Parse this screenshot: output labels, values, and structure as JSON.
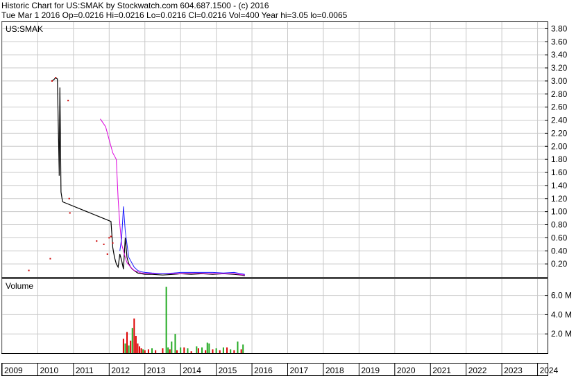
{
  "header": {
    "line1": "Historic Chart for US:SMAK by Stockwatch.com 604.687.1500 - (c) 2016",
    "line2": "Tue Mar  1 2016  Op=0.0216  Hi=0.0216  Lo=0.0216  Cl=0.0216  Vol=400  Year hi=3.05  lo=0.0065"
  },
  "colors": {
    "grid": "#c8c8c8",
    "price": "#000000",
    "price_dots": "#cc0000",
    "ma_short": "#1a1aff",
    "ma_long": "#dd00dd",
    "volume_up": "#22aa22",
    "volume_down": "#dd0000"
  },
  "chart_data": [
    {
      "type": "line",
      "title": "US:SMAK",
      "ylim": [
        0,
        3.9
      ],
      "xlim": [
        2009,
        2024.3
      ],
      "y_ticks": [
        "0.20",
        "0.40",
        "0.60",
        "0.80",
        "1.00",
        "1.20",
        "1.40",
        "1.60",
        "1.80",
        "2.00",
        "2.20",
        "2.40",
        "2.60",
        "2.80",
        "3.00",
        "3.20",
        "3.40",
        "3.60",
        "3.80"
      ],
      "x_ticks": [
        "2009",
        "2010",
        "2011",
        "2012",
        "2013",
        "2014",
        "2015",
        "2016",
        "2017",
        "2018",
        "2019",
        "2020",
        "2021",
        "2022",
        "2023",
        "2024"
      ],
      "series": [
        {
          "key": "price",
          "x": [
            2010.4,
            2010.45,
            2010.5,
            2010.55,
            2010.6,
            2010.6,
            2010.62,
            2010.65,
            2010.68,
            2010.7,
            2012.05,
            2012.1,
            2012.15,
            2012.2,
            2012.25,
            2012.3,
            2012.35,
            2012.4,
            2012.45,
            2012.5,
            2012.55,
            2012.6,
            2012.65,
            2012.7,
            2012.75,
            2012.8,
            2012.9,
            2013.0,
            2013.2,
            2013.5,
            2013.8,
            2014.0,
            2014.3,
            2014.6,
            2014.9,
            2015.2,
            2015.5,
            2015.7,
            2015.8
          ],
          "y": [
            3.0,
            3.02,
            3.05,
            3.03,
            1.6,
            1.55,
            2.9,
            1.3,
            1.2,
            1.15,
            0.85,
            0.45,
            0.3,
            0.2,
            0.15,
            0.35,
            0.25,
            0.12,
            0.6,
            0.3,
            0.2,
            0.15,
            0.12,
            0.1,
            0.08,
            0.06,
            0.05,
            0.04,
            0.04,
            0.03,
            0.04,
            0.05,
            0.04,
            0.05,
            0.04,
            0.05,
            0.04,
            0.03,
            0.02
          ]
        },
        {
          "key": "price_dots",
          "x": [
            2009.75,
            2010.35,
            2010.4,
            2010.5,
            2010.85,
            2010.88,
            2010.9,
            2011.65,
            2011.85,
            2011.95,
            2012.0,
            2012.05,
            2012.1
          ],
          "y": [
            0.1,
            0.28,
            3.0,
            3.05,
            2.7,
            1.2,
            0.98,
            0.55,
            0.5,
            0.35,
            0.6,
            0.62,
            0.52
          ]
        },
        {
          "key": "ma_long",
          "x": [
            2011.75,
            2011.9,
            2012.0,
            2012.1,
            2012.2,
            2012.25,
            2012.3,
            2012.35,
            2012.4,
            2012.45,
            2012.5,
            2012.6,
            2012.7,
            2012.9,
            2013.2,
            2013.6,
            2014.0,
            2014.4,
            2014.8,
            2015.2,
            2015.5,
            2015.8
          ],
          "y": [
            2.42,
            2.3,
            2.1,
            1.9,
            1.8,
            1.2,
            0.8,
            0.5,
            0.4,
            0.3,
            0.22,
            0.15,
            0.1,
            0.06,
            0.05,
            0.05,
            0.05,
            0.06,
            0.05,
            0.05,
            0.05,
            0.03
          ]
        },
        {
          "key": "ma_short",
          "x": [
            2012.3,
            2012.35,
            2012.4,
            2012.45,
            2012.5,
            2012.55,
            2012.6,
            2012.65,
            2012.7,
            2012.8,
            2012.9,
            2013.0,
            2013.2,
            2013.5,
            2013.8,
            2014.0,
            2014.3,
            2014.6,
            2014.9,
            2015.2,
            2015.5,
            2015.8
          ],
          "y": [
            0.4,
            0.6,
            1.08,
            0.7,
            0.5,
            0.3,
            0.25,
            0.2,
            0.15,
            0.1,
            0.08,
            0.07,
            0.06,
            0.05,
            0.06,
            0.07,
            0.07,
            0.07,
            0.07,
            0.06,
            0.07,
            0.04
          ]
        }
      ]
    },
    {
      "type": "bar",
      "title": "Volume",
      "ylim": [
        0,
        7.7
      ],
      "y_ticks": [
        "2.0 M",
        "4.0 M",
        "6.0 M"
      ],
      "series": [
        {
          "key": "volume_down",
          "x": [
            2012.4,
            2012.5,
            2012.6,
            2012.7,
            2012.75,
            2012.8,
            2012.85,
            2012.9,
            2013.0,
            2013.1,
            2013.3,
            2013.5,
            2013.7,
            2013.9,
            2014.1,
            2014.3,
            2014.5,
            2014.7,
            2014.9,
            2015.1,
            2015.3,
            2015.5,
            2015.7
          ],
          "y": [
            1.5,
            2.2,
            1.3,
            3.6,
            1.8,
            1.0,
            0.7,
            0.5,
            0.3,
            0.4,
            0.3,
            0.5,
            0.4,
            0.3,
            0.6,
            0.2,
            0.5,
            0.3,
            0.4,
            0.3,
            0.6,
            0.3,
            0.4
          ]
        },
        {
          "key": "volume_up",
          "x": [
            2012.45,
            2012.55,
            2012.65,
            2012.95,
            2013.2,
            2013.6,
            2013.65,
            2013.75,
            2013.85,
            2014.0,
            2014.2,
            2014.45,
            2014.6,
            2014.75,
            2014.8,
            2015.0,
            2015.2,
            2015.4,
            2015.6,
            2015.75
          ],
          "y": [
            1.0,
            0.8,
            2.6,
            0.4,
            0.5,
            6.9,
            0.6,
            1.2,
            2.0,
            0.6,
            0.5,
            0.7,
            0.6,
            1.1,
            1.0,
            0.5,
            0.6,
            0.4,
            1.2,
            0.9
          ]
        }
      ]
    }
  ]
}
